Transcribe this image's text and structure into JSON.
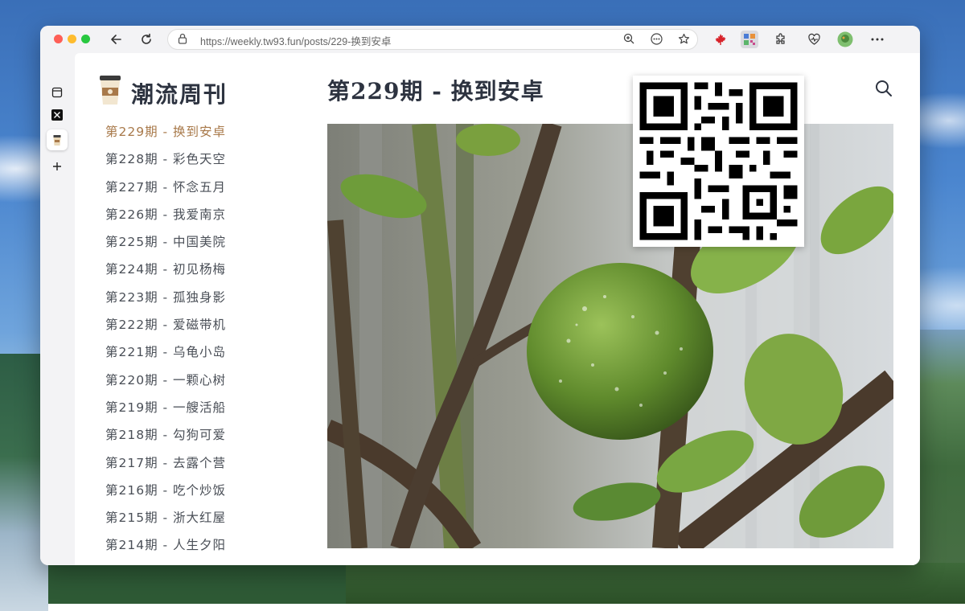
{
  "browser": {
    "url_host": "https://weekly.tw93.fun",
    "url_path": "/posts/229-换到安卓"
  },
  "site": {
    "title": "潮流周刊"
  },
  "post": {
    "title": "第229期 - 换到安卓"
  },
  "posts": [
    {
      "label": "第229期 - 换到安卓",
      "active": true
    },
    {
      "label": "第228期 - 彩色天空"
    },
    {
      "label": "第227期 - 怀念五月"
    },
    {
      "label": "第226期 - 我爱南京"
    },
    {
      "label": "第225期 - 中国美院"
    },
    {
      "label": "第224期 - 初见杨梅"
    },
    {
      "label": "第223期 - 孤独身影"
    },
    {
      "label": "第222期 - 爱磁带机"
    },
    {
      "label": "第221期 - 乌龟小岛"
    },
    {
      "label": "第220期 - 一颗心树"
    },
    {
      "label": "第219期 - 一艘活船"
    },
    {
      "label": "第218期 - 勾狗可爱"
    },
    {
      "label": "第217期 - 去露个营"
    },
    {
      "label": "第216期 - 吃个炒饭"
    },
    {
      "label": "第215期 - 浙大红屋"
    },
    {
      "label": "第214期 - 人生夕阳"
    }
  ],
  "colors": {
    "active_link": "#a8794a",
    "text": "#4a4f57",
    "heading": "#2d3340"
  },
  "icons": {
    "back": "arrow-left-icon",
    "reload": "reload-icon",
    "zoom": "zoom-icon",
    "more": "more-icon",
    "bookmark": "star-icon",
    "search": "search-icon"
  }
}
